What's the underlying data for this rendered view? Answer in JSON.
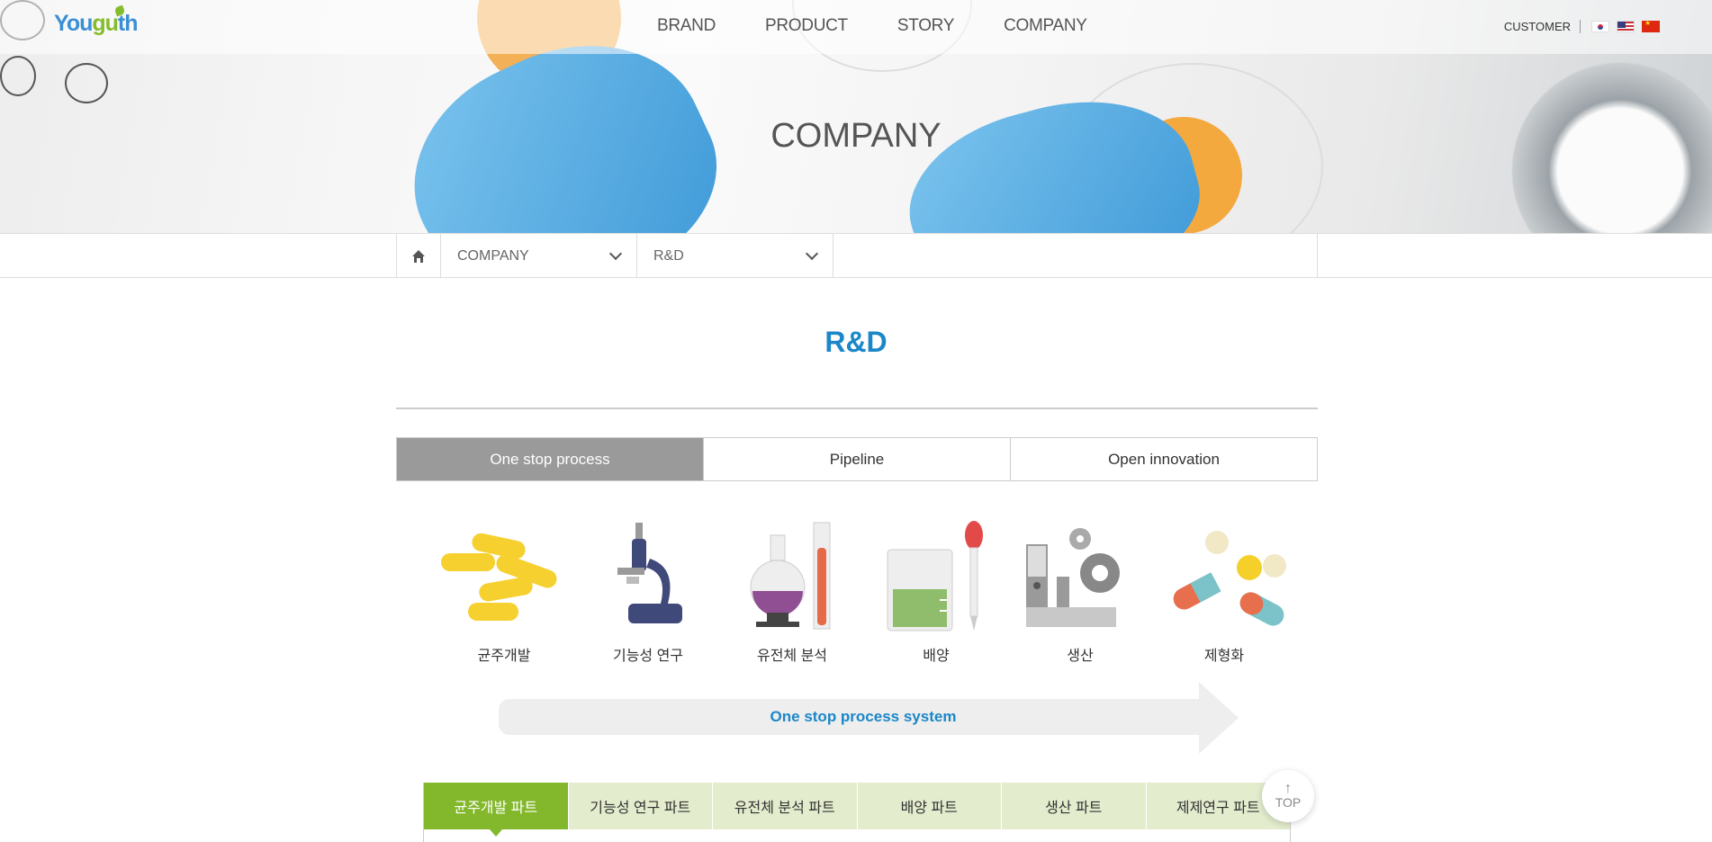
{
  "header": {
    "logo_text": "Youguth",
    "nav": [
      "BRAND",
      "PRODUCT",
      "STORY",
      "COMPANY"
    ],
    "customer": "CUSTOMER",
    "languages": [
      "Korean",
      "English",
      "Chinese"
    ]
  },
  "hero": {
    "title": "COMPANY"
  },
  "subnav": {
    "level1": "COMPANY",
    "level2": "R&D"
  },
  "page": {
    "title": "R&D"
  },
  "tabs": [
    "One stop process",
    "Pipeline",
    "Open innovation"
  ],
  "steps": [
    "균주개발",
    "기능성 연구",
    "유전체 분석",
    "배양",
    "생산",
    "제형화"
  ],
  "process_label": "One stop process system",
  "parts": [
    "균주개발 파트",
    "기능성 연구 파트",
    "유전체 분석 파트",
    "배양 파트",
    "생산 파트",
    "제제연구 파트"
  ],
  "top_button": "TOP",
  "colors": {
    "accent_blue": "#1b87c9",
    "accent_green": "#84b82c",
    "tab_active": "#9a9a9a"
  }
}
